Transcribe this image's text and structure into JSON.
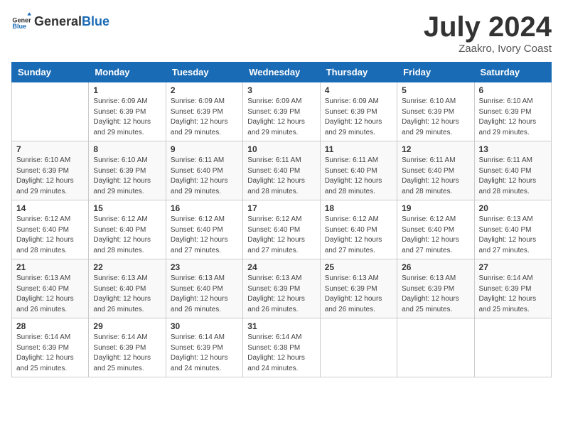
{
  "logo": {
    "general": "General",
    "blue": "Blue"
  },
  "title": {
    "month_year": "July 2024",
    "location": "Zaakro, Ivory Coast"
  },
  "days_of_week": [
    "Sunday",
    "Monday",
    "Tuesday",
    "Wednesday",
    "Thursday",
    "Friday",
    "Saturday"
  ],
  "weeks": [
    [
      {
        "day": "",
        "info": ""
      },
      {
        "day": "1",
        "info": "Sunrise: 6:09 AM\nSunset: 6:39 PM\nDaylight: 12 hours\nand 29 minutes."
      },
      {
        "day": "2",
        "info": "Sunrise: 6:09 AM\nSunset: 6:39 PM\nDaylight: 12 hours\nand 29 minutes."
      },
      {
        "day": "3",
        "info": "Sunrise: 6:09 AM\nSunset: 6:39 PM\nDaylight: 12 hours\nand 29 minutes."
      },
      {
        "day": "4",
        "info": "Sunrise: 6:09 AM\nSunset: 6:39 PM\nDaylight: 12 hours\nand 29 minutes."
      },
      {
        "day": "5",
        "info": "Sunrise: 6:10 AM\nSunset: 6:39 PM\nDaylight: 12 hours\nand 29 minutes."
      },
      {
        "day": "6",
        "info": "Sunrise: 6:10 AM\nSunset: 6:39 PM\nDaylight: 12 hours\nand 29 minutes."
      }
    ],
    [
      {
        "day": "7",
        "info": "Sunrise: 6:10 AM\nSunset: 6:39 PM\nDaylight: 12 hours\nand 29 minutes."
      },
      {
        "day": "8",
        "info": "Sunrise: 6:10 AM\nSunset: 6:39 PM\nDaylight: 12 hours\nand 29 minutes."
      },
      {
        "day": "9",
        "info": "Sunrise: 6:11 AM\nSunset: 6:40 PM\nDaylight: 12 hours\nand 29 minutes."
      },
      {
        "day": "10",
        "info": "Sunrise: 6:11 AM\nSunset: 6:40 PM\nDaylight: 12 hours\nand 28 minutes."
      },
      {
        "day": "11",
        "info": "Sunrise: 6:11 AM\nSunset: 6:40 PM\nDaylight: 12 hours\nand 28 minutes."
      },
      {
        "day": "12",
        "info": "Sunrise: 6:11 AM\nSunset: 6:40 PM\nDaylight: 12 hours\nand 28 minutes."
      },
      {
        "day": "13",
        "info": "Sunrise: 6:11 AM\nSunset: 6:40 PM\nDaylight: 12 hours\nand 28 minutes."
      }
    ],
    [
      {
        "day": "14",
        "info": "Sunrise: 6:12 AM\nSunset: 6:40 PM\nDaylight: 12 hours\nand 28 minutes."
      },
      {
        "day": "15",
        "info": "Sunrise: 6:12 AM\nSunset: 6:40 PM\nDaylight: 12 hours\nand 28 minutes."
      },
      {
        "day": "16",
        "info": "Sunrise: 6:12 AM\nSunset: 6:40 PM\nDaylight: 12 hours\nand 27 minutes."
      },
      {
        "day": "17",
        "info": "Sunrise: 6:12 AM\nSunset: 6:40 PM\nDaylight: 12 hours\nand 27 minutes."
      },
      {
        "day": "18",
        "info": "Sunrise: 6:12 AM\nSunset: 6:40 PM\nDaylight: 12 hours\nand 27 minutes."
      },
      {
        "day": "19",
        "info": "Sunrise: 6:12 AM\nSunset: 6:40 PM\nDaylight: 12 hours\nand 27 minutes."
      },
      {
        "day": "20",
        "info": "Sunrise: 6:13 AM\nSunset: 6:40 PM\nDaylight: 12 hours\nand 27 minutes."
      }
    ],
    [
      {
        "day": "21",
        "info": "Sunrise: 6:13 AM\nSunset: 6:40 PM\nDaylight: 12 hours\nand 26 minutes."
      },
      {
        "day": "22",
        "info": "Sunrise: 6:13 AM\nSunset: 6:40 PM\nDaylight: 12 hours\nand 26 minutes."
      },
      {
        "day": "23",
        "info": "Sunrise: 6:13 AM\nSunset: 6:40 PM\nDaylight: 12 hours\nand 26 minutes."
      },
      {
        "day": "24",
        "info": "Sunrise: 6:13 AM\nSunset: 6:39 PM\nDaylight: 12 hours\nand 26 minutes."
      },
      {
        "day": "25",
        "info": "Sunrise: 6:13 AM\nSunset: 6:39 PM\nDaylight: 12 hours\nand 26 minutes."
      },
      {
        "day": "26",
        "info": "Sunrise: 6:13 AM\nSunset: 6:39 PM\nDaylight: 12 hours\nand 25 minutes."
      },
      {
        "day": "27",
        "info": "Sunrise: 6:14 AM\nSunset: 6:39 PM\nDaylight: 12 hours\nand 25 minutes."
      }
    ],
    [
      {
        "day": "28",
        "info": "Sunrise: 6:14 AM\nSunset: 6:39 PM\nDaylight: 12 hours\nand 25 minutes."
      },
      {
        "day": "29",
        "info": "Sunrise: 6:14 AM\nSunset: 6:39 PM\nDaylight: 12 hours\nand 25 minutes."
      },
      {
        "day": "30",
        "info": "Sunrise: 6:14 AM\nSunset: 6:39 PM\nDaylight: 12 hours\nand 24 minutes."
      },
      {
        "day": "31",
        "info": "Sunrise: 6:14 AM\nSunset: 6:38 PM\nDaylight: 12 hours\nand 24 minutes."
      },
      {
        "day": "",
        "info": ""
      },
      {
        "day": "",
        "info": ""
      },
      {
        "day": "",
        "info": ""
      }
    ]
  ]
}
